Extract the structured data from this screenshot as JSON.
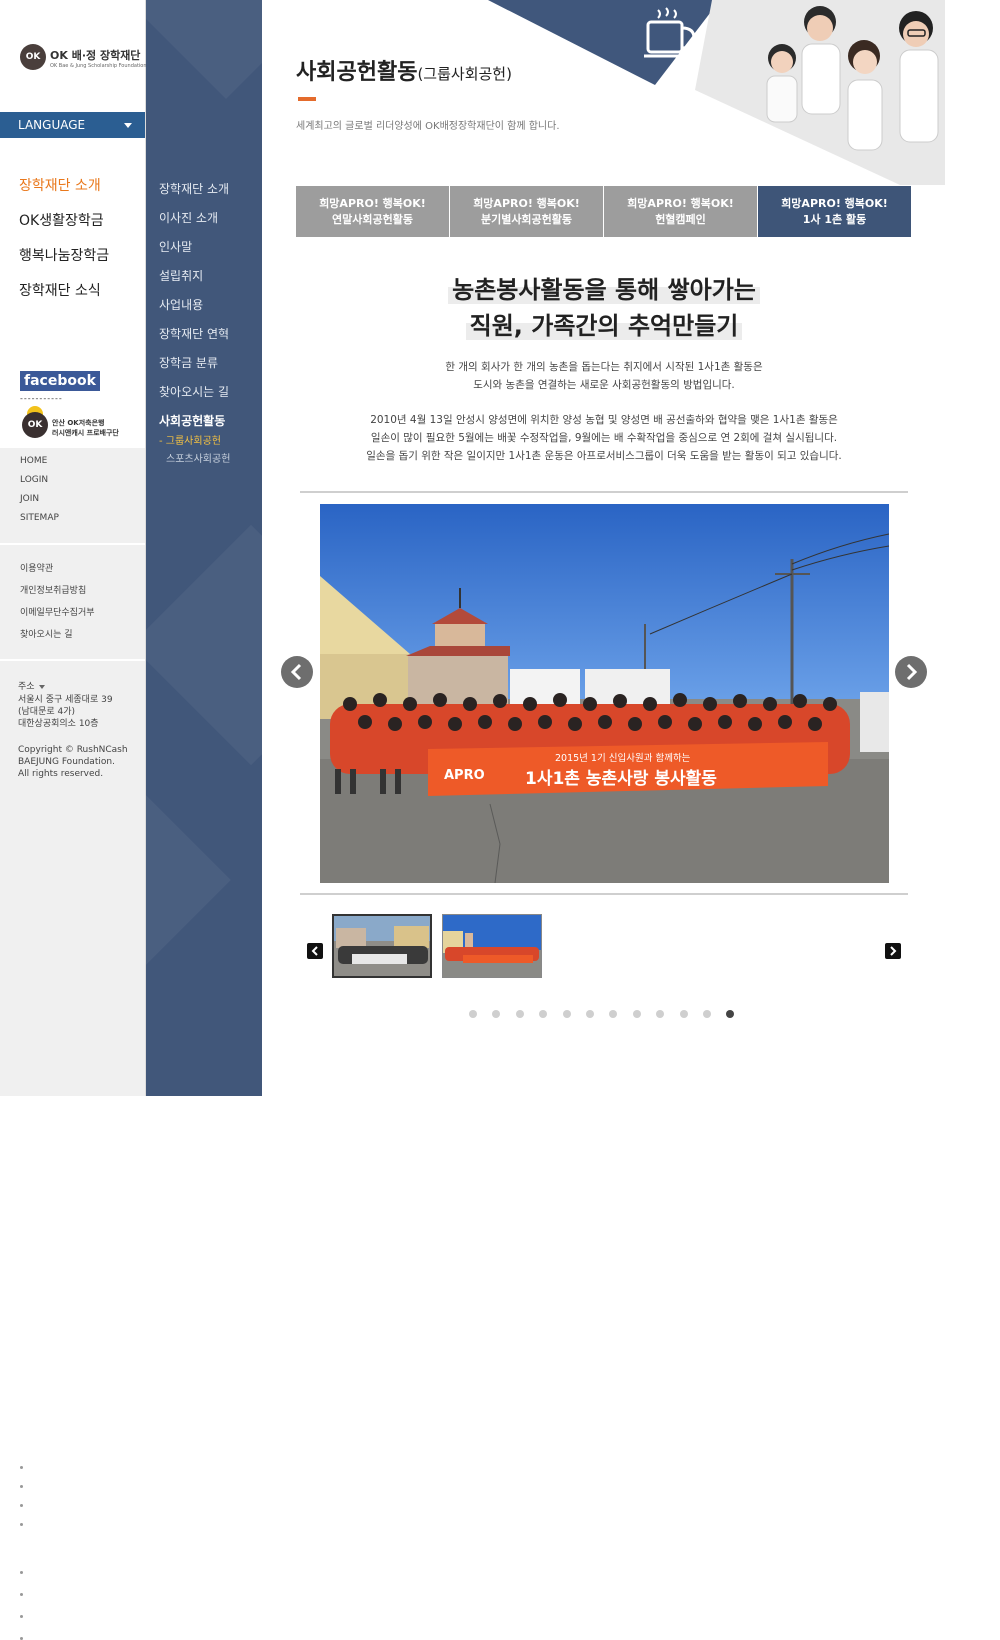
{
  "logo": {
    "mark": "OK",
    "title": "OK 배·정 장학재단",
    "subtitle": "OK Bae & Jung Scholarship Foundation"
  },
  "language": {
    "label": "LANGUAGE"
  },
  "main_menu": [
    {
      "label": "장학재단 소개",
      "active": true
    },
    {
      "label": "OK생활장학금"
    },
    {
      "label": "행복나눔장학금"
    },
    {
      "label": "장학재단 소식"
    }
  ],
  "facebook": {
    "label": "facebook",
    "dashes": "-----------"
  },
  "ok_bank": {
    "mark": "OK",
    "line1": "안산 OK저축은행",
    "line2": "러시앤캐시 프로배구단"
  },
  "util_links": [
    "HOME",
    "LOGIN",
    "JOIN",
    "SITEMAP"
  ],
  "policy_links": [
    "이용약관",
    "개인정보취급방침",
    "이메일무단수집거부",
    "찾아오시는 길"
  ],
  "address": {
    "label": "주소",
    "lines": [
      "서울시 중구 세종대로 39",
      "(남대문로 4가)",
      "대한상공회의소 10층"
    ],
    "copyright": [
      "Copyright  © RushNCash",
      "BAEJUNG Foundation.",
      "All rights reserved."
    ]
  },
  "sub_menu": [
    "장학재단 소개",
    "이사진 소개",
    "인사말",
    "설립취지",
    "사업내용",
    "장학재단 연혁",
    "장학금 분류",
    "찾아오시는 길",
    "사회공헌활동"
  ],
  "sub_sub_menu": [
    {
      "label": "- 그룹사회공헌",
      "active": true
    },
    {
      "label": "스포츠사회공헌"
    }
  ],
  "page": {
    "title": "사회공헌활동",
    "title_suffix": "(그룹사회공헌)",
    "subtitle": "세계최고의 글로벌 리더양성에 OK배정장학재단이 함께 합니다."
  },
  "tabs": [
    {
      "line1": "희망APRO! 행복OK!",
      "line2": "연말사회공헌활동"
    },
    {
      "line1": "희망APRO! 행복OK!",
      "line2": "분기별사회공헌활동"
    },
    {
      "line1": "희망APRO! 행복OK!",
      "line2": "헌혈캠페인"
    },
    {
      "line1": "희망APRO! 행복OK!",
      "line2": "1사 1촌 활동",
      "active": true
    }
  ],
  "article": {
    "headline": [
      "농촌봉사활동을 통해 쌓아가는",
      "직원, 가족간의 추억만들기"
    ],
    "para1": [
      "한 개의 회사가 한 개의 농촌을 돕는다는 취지에서 시작된 1사1촌 활동은",
      "도시와 농촌을 연결하는 새로운 사회공헌활동의 방법입니다."
    ],
    "para2": [
      "2010년 4월 13일 안성시 양성면에 위치한 양성 농협 및 양성면 배 공선출하와 협약을 맺은 1사1촌 활동은",
      "일손이 많이 필요한 5월에는 배꽃 수정작업을, 9월에는 배 수확작업을 중심으로 연 2회에 걸쳐 실시됩니다.",
      "일손을 돕기 위한 작은 일이지만 1사1촌 운동은 아프로서비스그룹이 더욱 도움을 받는 활동이 되고 있습니다."
    ]
  },
  "slider": {
    "banner_small": "2015년 1기 신입사원과 함께하는",
    "banner_big": "1사1촌 농촌사랑 봉사활동",
    "banner_logo": "APRO",
    "dot_count": 12,
    "active_dot": 11
  },
  "colors": {
    "nav_blue": "#41577a",
    "lang_blue": "#2b5e92",
    "accent_orange": "#e9781c",
    "tab_gray": "#9d9d9d"
  }
}
